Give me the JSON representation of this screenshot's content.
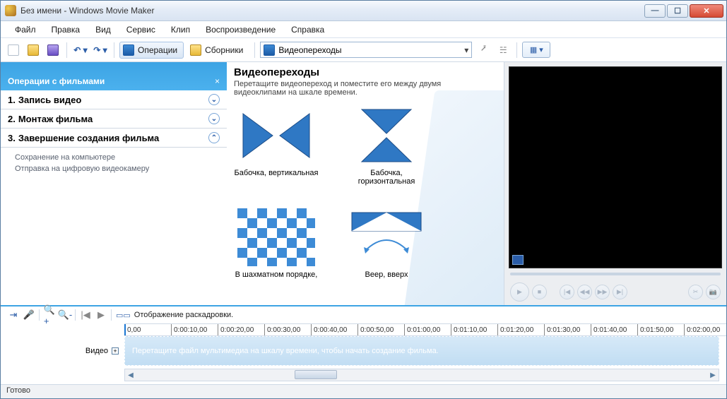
{
  "window": {
    "title": "Без имени - Windows Movie Maker"
  },
  "menu": [
    "Файл",
    "Правка",
    "Вид",
    "Сервис",
    "Клип",
    "Воспроизведение",
    "Справка"
  ],
  "toolbar": {
    "operations": "Операции",
    "collections": "Сборники",
    "address": "Видеопереходы"
  },
  "taskpane": {
    "header": "Операции с фильмами",
    "items": [
      {
        "num": "1.",
        "label": "Запись видео"
      },
      {
        "num": "2.",
        "label": "Монтаж фильма"
      },
      {
        "num": "3.",
        "label": "Завершение создания фильма"
      }
    ],
    "subs": [
      "Сохранение на компьютере",
      "Отправка на цифровую видеокамеру"
    ]
  },
  "content": {
    "title": "Видеопереходы",
    "desc": "Перетащите видеопереход и поместите его между двумя видеоклипами на шкале времени.",
    "thumbs": [
      "Бабочка, вертикальная",
      "Бабочка, горизонтальная",
      "В шахматном порядке,",
      "Веер, вверх"
    ]
  },
  "timeline": {
    "toggle_label": "Отображение раскадровки.",
    "marks": [
      "0,00",
      "0:00:10,00",
      "0:00:20,00",
      "0:00:30,00",
      "0:00:40,00",
      "0:00:50,00",
      "0:01:00,00",
      "0:01:10,00",
      "0:01:20,00",
      "0:01:30,00",
      "0:01:40,00",
      "0:01:50,00",
      "0:02:00,00"
    ],
    "track_label": "Видео",
    "drop_hint": "Перетащите файл мультимедиа на шкалу времени, чтобы начать создание фильма."
  },
  "status": "Готово"
}
